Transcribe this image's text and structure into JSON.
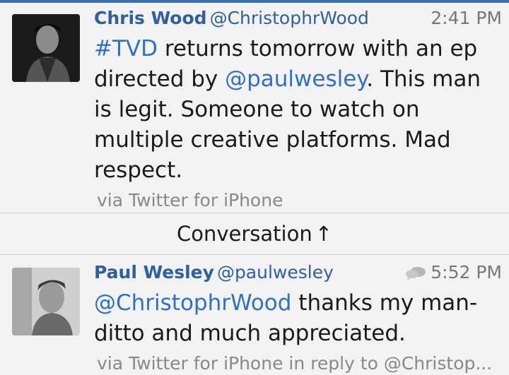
{
  "tweets": [
    {
      "name": "Chris Wood",
      "handle": "@ChristophrWood",
      "time": "2:41 PM",
      "text_parts": [
        {
          "text": "#TVD",
          "link": true
        },
        {
          "text": " returns tomorrow with an ep directed by ",
          "link": false
        },
        {
          "text": "@paulwesley",
          "link": true
        },
        {
          "text": ". This man is legit. Someone to watch on multiple creative platforms. Mad respect.",
          "link": false
        }
      ],
      "via": "via Twitter for iPhone"
    },
    {
      "name": "Paul Wesley",
      "handle": "@paulwesley",
      "time": "5:52 PM",
      "text_parts": [
        {
          "text": "@ChristophrWood",
          "link": true
        },
        {
          "text": " thanks my man- ditto and much appreciated.",
          "link": false
        }
      ],
      "via": "via Twitter for iPhone in reply to @Christop..."
    }
  ],
  "conversation": {
    "label": "Conversation",
    "arrow": "↑"
  },
  "colors": {
    "accent": "#2f5f9e",
    "link": "#2f70c0",
    "background": "#f2f2f2"
  },
  "icons": {
    "conversation": "speech-bubbles-icon"
  }
}
